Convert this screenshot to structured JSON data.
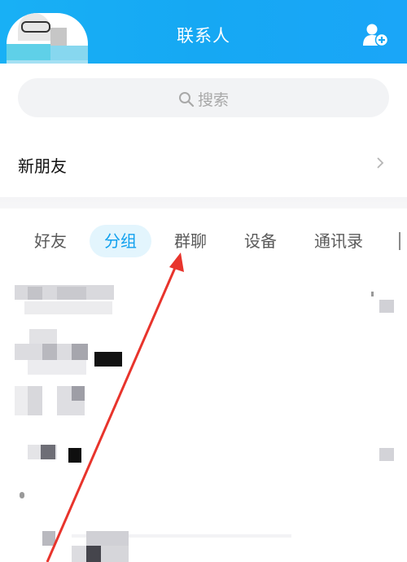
{
  "header": {
    "title": "联系人"
  },
  "search": {
    "placeholder": "搜索"
  },
  "new_friend": {
    "label": "新朋友"
  },
  "tabs": [
    {
      "label": "好友",
      "active": false
    },
    {
      "label": "分组",
      "active": true
    },
    {
      "label": "群聊",
      "active": false
    },
    {
      "label": "设备",
      "active": false
    },
    {
      "label": "通讯录",
      "active": false
    }
  ],
  "colors": {
    "header": "#16a8f3",
    "active_tab_text": "#12a1ee",
    "active_tab_bg": "#e3f5fd",
    "annotation_arrow": "#e8342c"
  },
  "icons": {
    "add_friend": "add-person-icon",
    "search": "search-icon",
    "chevron": "chevron-right-icon"
  }
}
